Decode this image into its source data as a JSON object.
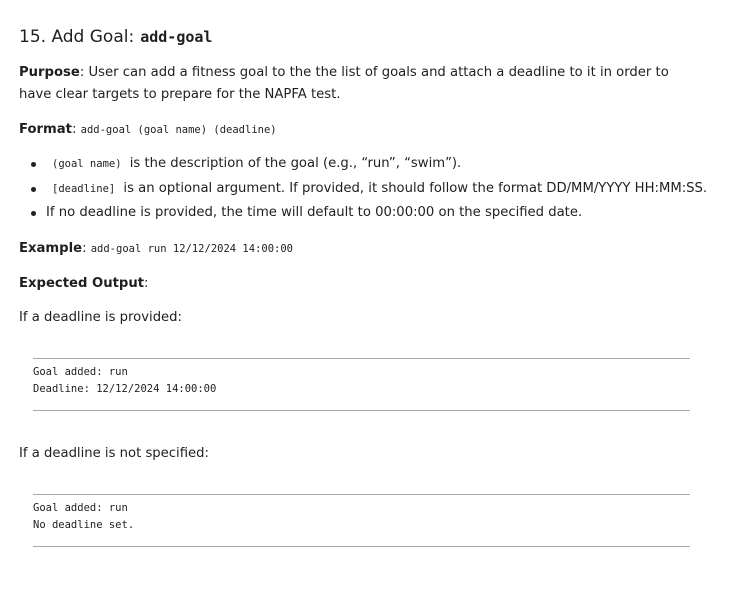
{
  "heading": {
    "number_title": "15. Add Goal:",
    "command": "add-goal"
  },
  "purpose": {
    "label": "Purpose",
    "text": ": User can add a fitness goal to the the list of goals and attach a deadline to it in order to have clear targets to prepare for the NAPFA test."
  },
  "format": {
    "label": "Format",
    "sep": ":",
    "code": "add-goal (goal name) (deadline)"
  },
  "bullets": [
    {
      "code": "(goal name)",
      "text": "is the description of the goal (e.g., “run”, “swim”)."
    },
    {
      "code": "[deadline]",
      "text": "is an optional argument. If provided, it should follow the format DD/MM/YYYY HH:MM:SS."
    },
    {
      "text": "If no deadline is provided, the time will default to 00:00:00 on the specified date."
    }
  ],
  "example": {
    "label": "Example",
    "sep": ":",
    "code": "add-goal run 12/12/2024 14:00:00"
  },
  "expected_output": {
    "label": "Expected Output",
    "sep": ":"
  },
  "case_with_deadline": {
    "caption": "If a deadline is provided:",
    "output_lines": [
      "Goal added: run",
      "Deadline: 12/12/2024 14:00:00"
    ]
  },
  "case_without_deadline": {
    "caption": "If a deadline is not specified:",
    "output_lines": [
      "Goal added: run",
      "No deadline set."
    ]
  }
}
